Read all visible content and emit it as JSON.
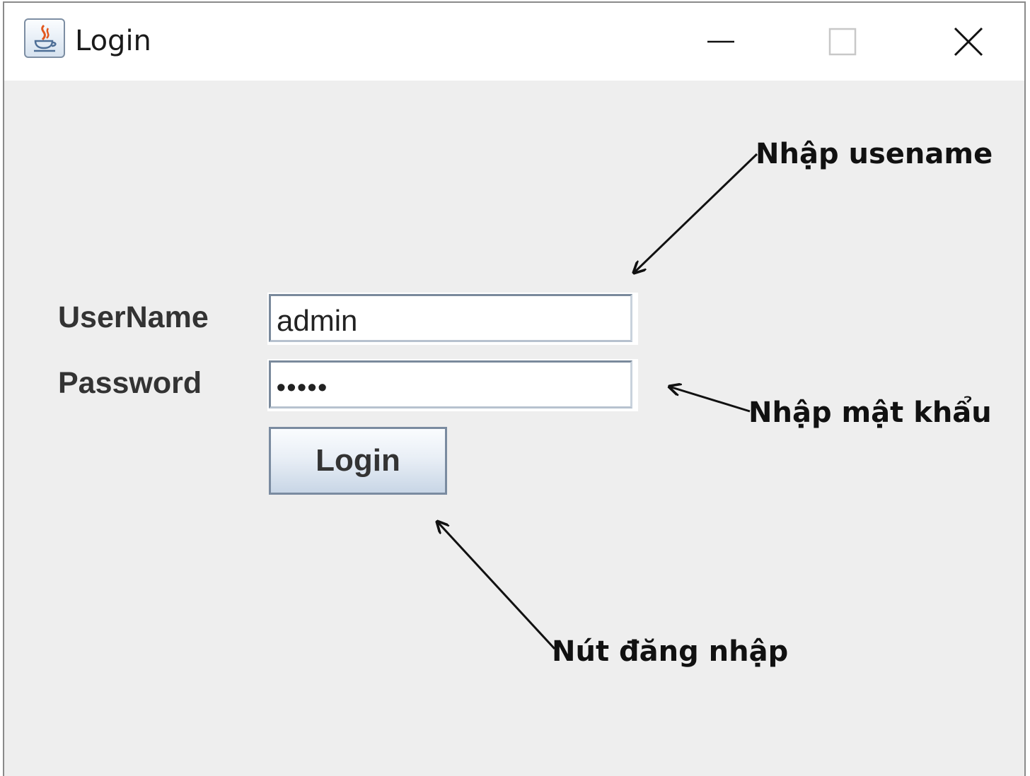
{
  "window": {
    "title": "Login",
    "app_icon": "java-cup-icon",
    "controls": [
      "minimize-icon",
      "maximize-icon",
      "close-icon"
    ]
  },
  "form": {
    "username_label": "UserName",
    "username_value": "admin",
    "password_label": "Password",
    "password_value": "•••••",
    "login_button_label": "Login"
  },
  "annotations": {
    "username_hint": "Nhập usename",
    "password_hint": "Nhập mật khẩu",
    "button_hint": "Nút đăng nhập"
  },
  "colors": {
    "window_background": "#eeeeee",
    "titlebar_background": "#ffffff",
    "label_text": "#333333",
    "annotation_text": "#111111"
  }
}
